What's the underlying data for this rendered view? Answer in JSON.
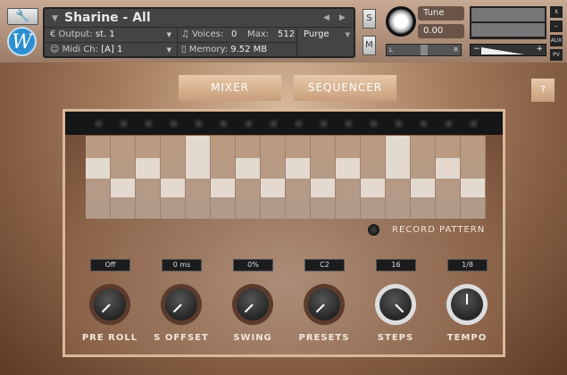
{
  "header": {
    "instrument": "Sharine - All",
    "output_label": "Output:",
    "output": "st. 1",
    "midi_label": "Midi Ch:",
    "midi": "[A] 1",
    "voices_label": "Voices:",
    "voices": "0",
    "max_label": "Max:",
    "max": "512",
    "memory_label": "Memory:",
    "memory": "9.52 MB",
    "purge": "Purge",
    "solo": "S",
    "mute": "M",
    "tune_label": "Tune",
    "tune_value": "0.00",
    "pan_l": "L",
    "pan_r": "R",
    "vol_minus": "−",
    "vol_plus": "+",
    "close": "X",
    "minimize": "−",
    "aux": "AUX",
    "pv": "PV",
    "logo": "W"
  },
  "tabs": {
    "mixer": "MIXER",
    "sequencer": "SEQUENCER",
    "help": "?"
  },
  "sequencer": {
    "steps": [
      2,
      1,
      2,
      1,
      3,
      1,
      2,
      1,
      2,
      1,
      2,
      1,
      3,
      1,
      2,
      1
    ],
    "record_label": "RECORD PATTERN"
  },
  "controls": [
    {
      "label": "PRE ROLL",
      "value": "Off",
      "angle": -135,
      "ring": 0
    },
    {
      "label": "S OFFSET",
      "value": "0 ms",
      "angle": -135,
      "ring": 0
    },
    {
      "label": "SWING",
      "value": "0%",
      "angle": -135,
      "ring": 0
    },
    {
      "label": "PRESETS",
      "value": "C2",
      "angle": -135,
      "ring": 0
    },
    {
      "label": "STEPS",
      "value": "16",
      "angle": 135,
      "ring": 1
    },
    {
      "label": "TEMPO",
      "value": "1/8",
      "angle": 0,
      "ring": 0.5
    }
  ]
}
